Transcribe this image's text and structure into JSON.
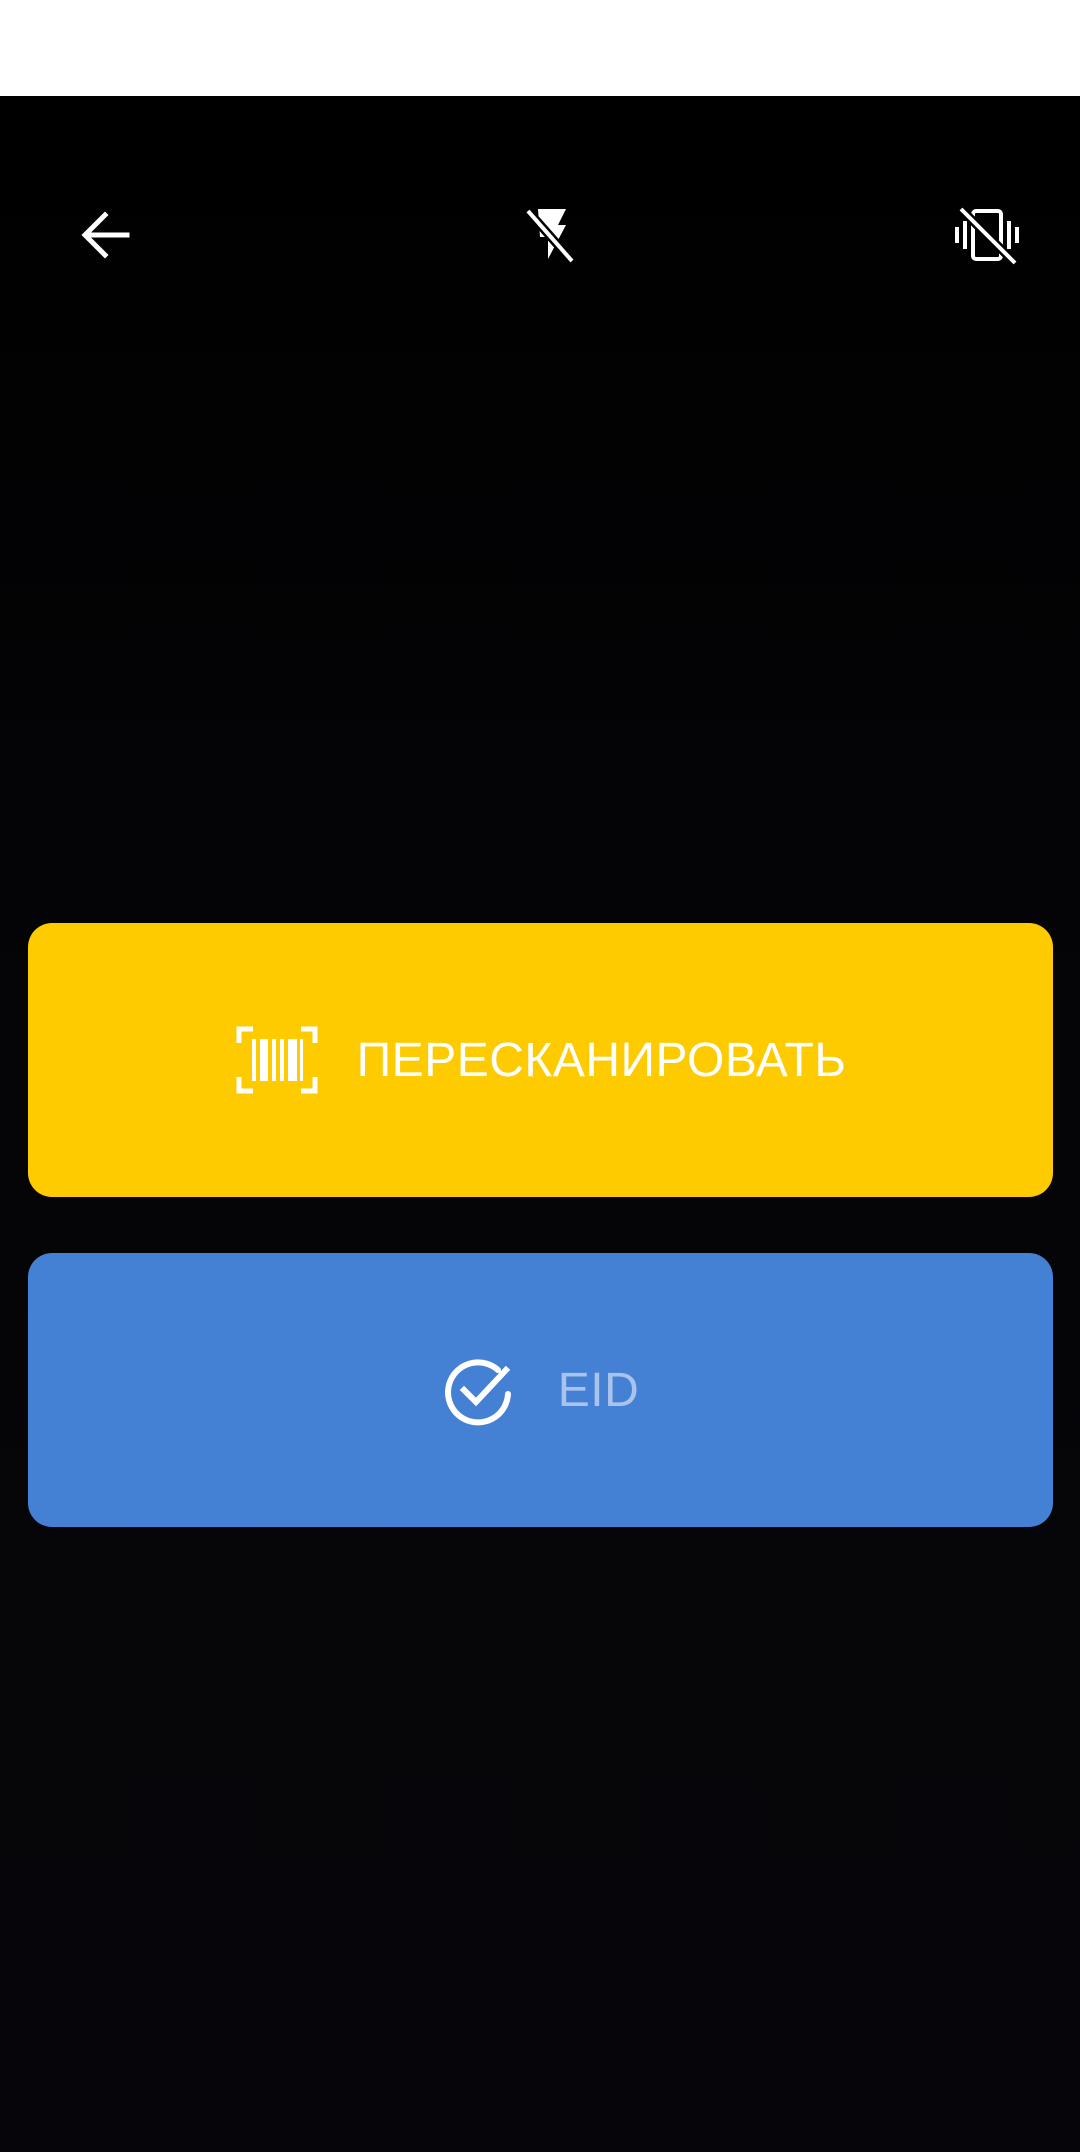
{
  "toolbar": {
    "back_icon": "arrow-left-icon",
    "flash_icon": "flash-off-icon",
    "vibrate_icon": "vibrate-off-icon"
  },
  "actions": {
    "rescan": {
      "label": "ПЕРЕСКАНИРОВАТЬ",
      "icon": "barcode-scan-icon",
      "color": "#FECB00"
    },
    "eid": {
      "label": "EID",
      "icon": "check-circle-icon",
      "color": "#4480D4"
    }
  },
  "colors": {
    "background": "#050508",
    "status_strip": "#FFFFFF"
  }
}
